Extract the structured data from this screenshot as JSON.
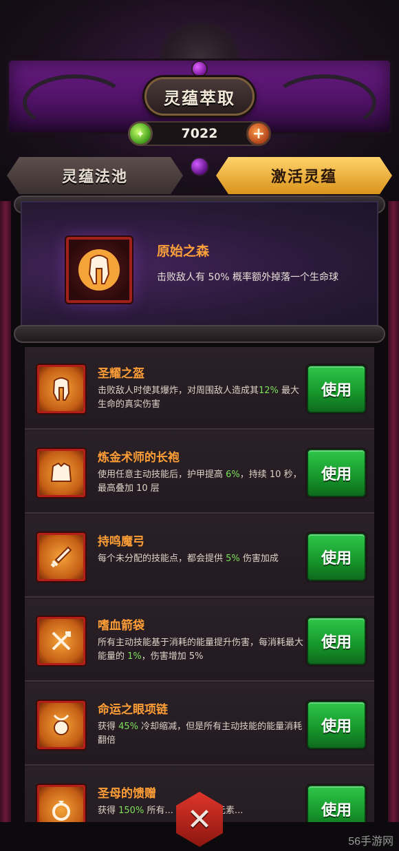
{
  "header": {
    "title": "灵蕴萃取",
    "currency_value": "7022",
    "currency_icon": "soul-orb-icon",
    "add_icon": "plus-icon"
  },
  "tabs": [
    {
      "label": "灵蕴法池",
      "active": false
    },
    {
      "label": "激活灵蕴",
      "active": true
    }
  ],
  "featured": {
    "icon": "spartan-helmet-icon",
    "title": "原始之森",
    "desc": "击败敌人有 50% 概率额外掉落一个生命球"
  },
  "items": [
    {
      "icon": "helmet-icon",
      "title": "圣耀之盔",
      "desc_pre": "击败敌人时使其爆炸，对周围敌人造成其",
      "desc_hl": "12%",
      "desc_post": " 最大生命的真实伤害",
      "button": "使用"
    },
    {
      "icon": "robe-icon",
      "title": "炼金术师的长袍",
      "desc_pre": "使用任意主动技能后，护甲提高 ",
      "desc_hl": "6%",
      "desc_post": "，持续 10 秒，最高叠加 10 层",
      "button": "使用"
    },
    {
      "icon": "sword-icon",
      "title": "持鸣魔弓",
      "desc_pre": "每个未分配的技能点，都会提供 ",
      "desc_hl": "5%",
      "desc_post": " 伤害加成",
      "button": "使用"
    },
    {
      "icon": "quiver-icon",
      "title": "嗜血箭袋",
      "desc_pre": "所有主动技能基于消耗的能量提升伤害，每消耗最大能量的 ",
      "desc_hl": "1%",
      "desc_post": "，伤害增加 5%",
      "button": "使用"
    },
    {
      "icon": "amulet-icon",
      "title": "命运之眼项链",
      "desc_pre": "获得 ",
      "desc_hl": "45%",
      "desc_post": " 冷却缩减，但是所有主动技能的能量消耗翻倍",
      "button": "使用"
    },
    {
      "icon": "ring-icon",
      "title": "圣母的馈赠",
      "desc_pre": "获得 ",
      "desc_hl": "150%",
      "desc_post": " 所有... 15% 所有元素...",
      "button": "使用"
    }
  ],
  "close_icon": "close-x-icon",
  "watermark": "56手游网",
  "colors": {
    "accent_orange": "#ff9e36",
    "use_green": "#16952a",
    "tab_gold": "#ffd36b",
    "highlight": "#7ce05a"
  }
}
